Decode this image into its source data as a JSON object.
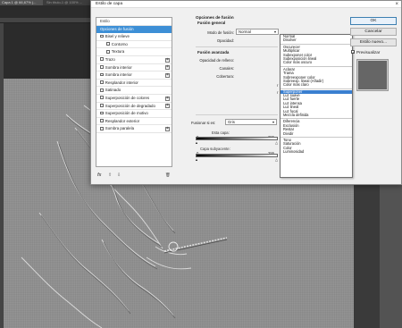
{
  "workspace": {
    "doc_tab": "Capa 1 @ 66,67% (...",
    "doc_tab2": "Sin título-1 @ 100% ..."
  },
  "dialog": {
    "title": "Estilo de capa",
    "close_glyph": "×",
    "styles_header": "Estilo",
    "styles": [
      {
        "label": "Opciones de fusión",
        "selected": true,
        "checkbox": false,
        "plus": false,
        "indent": false
      },
      {
        "label": "Bisel y relieve",
        "selected": false,
        "checkbox": true,
        "plus": false,
        "indent": false
      },
      {
        "label": "Contorno",
        "selected": false,
        "checkbox": true,
        "plus": false,
        "indent": true
      },
      {
        "label": "Textura",
        "selected": false,
        "checkbox": true,
        "plus": false,
        "indent": true
      },
      {
        "label": "Trazo",
        "selected": false,
        "checkbox": true,
        "plus": true,
        "indent": false
      },
      {
        "label": "Sombra interior",
        "selected": false,
        "checkbox": true,
        "plus": true,
        "indent": false
      },
      {
        "label": "Sombra interior",
        "selected": false,
        "checkbox": true,
        "plus": true,
        "indent": false
      },
      {
        "label": "Resplandor interior",
        "selected": false,
        "checkbox": true,
        "plus": false,
        "indent": false
      },
      {
        "label": "Satinado",
        "selected": false,
        "checkbox": true,
        "plus": false,
        "indent": false
      },
      {
        "label": "Superposición de colores",
        "selected": false,
        "checkbox": true,
        "plus": true,
        "indent": false
      },
      {
        "label": "Superposición de degradado",
        "selected": false,
        "checkbox": true,
        "plus": true,
        "indent": false
      },
      {
        "label": "Superposición de motivo",
        "selected": false,
        "checkbox": true,
        "plus": false,
        "indent": false
      },
      {
        "label": "Resplandor exterior",
        "selected": false,
        "checkbox": true,
        "plus": false,
        "indent": false
      },
      {
        "label": "Sombra paralela",
        "selected": false,
        "checkbox": true,
        "plus": true,
        "indent": false
      }
    ],
    "footer": {
      "fx": "fx",
      "up": "⇧",
      "down": "⇩",
      "trash": "🗑"
    },
    "blend_options": {
      "title": "Opciones de fusión",
      "subtitle": "Fusión general",
      "mode_label": "Modo de fusión:",
      "mode_value": "Normal",
      "opacity_label": "Opacidad:",
      "advanced_title": "Fusión avanzada",
      "fill_opacity_label": "Opacidad de relleno:",
      "channels_label": "Canales:",
      "knockout_label": "Cobertura:",
      "blend_if_label": "Fusionar si es:",
      "blend_if_value": "Gris",
      "this_layer_label": "Esta capa:",
      "this_layer_values": [
        "0",
        "255"
      ],
      "under_layer_label": "Capa subyacente:",
      "under_layer_values": [
        "0",
        "255"
      ]
    },
    "dropdown_options": [
      "Normal",
      "Disolver",
      "---",
      "Oscurecer",
      "Multiplicar",
      "Subexponer color",
      "Subexposición lineal",
      "Color más oscuro",
      "---",
      "Aclarar",
      "Trama",
      "Sobreexponer color",
      "Sobreexp. lineal (Añadir)",
      "Color más claro",
      "---",
      "Superponer",
      "Luz suave",
      "Luz fuerte",
      "Luz intensa",
      "Luz lineal",
      "Luz focal",
      "Mezcla definida",
      "---",
      "Diferencia",
      "Exclusión",
      "Restar",
      "Dividir",
      "---",
      "Tono",
      "Saturación",
      "Color",
      "Luminosidad"
    ],
    "dropdown_highlight": "Superponer",
    "buttons": {
      "ok": "OK",
      "cancel": "Cancelar",
      "new_style": "Estilo nuevo..."
    },
    "preview_label": "Previsualizar",
    "preview_checked": true
  }
}
